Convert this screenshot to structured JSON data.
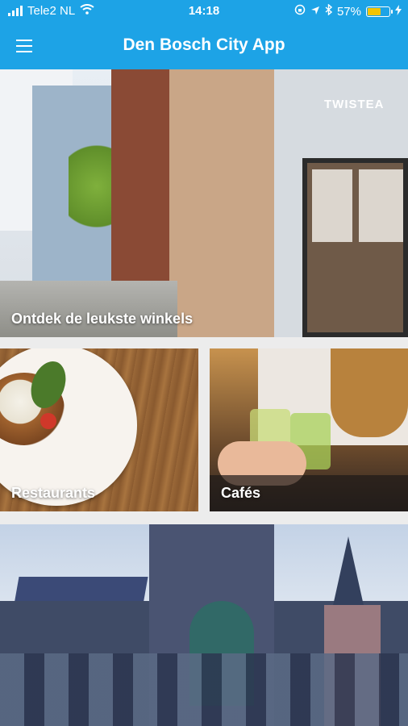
{
  "status_bar": {
    "carrier": "Tele2 NL",
    "time": "14:18",
    "battery_percent": "57%",
    "battery_level": 0.57,
    "icons": [
      "signal-icon",
      "wifi-icon",
      "rotation-lock-icon",
      "location-icon",
      "bluetooth-icon",
      "battery-icon",
      "charging-icon"
    ]
  },
  "app_bar": {
    "title": "Den Bosch City App",
    "menu_icon": "hamburger-menu-icon"
  },
  "tiles": {
    "shops": {
      "label": "Ontdek de leukste winkels",
      "sign_text": "TWISTEA"
    },
    "restaurants": {
      "label": "Restaurants"
    },
    "cafes": {
      "label": "Cafés"
    },
    "cathedral": {
      "label": ""
    }
  },
  "colors": {
    "primary": "#1da3e6",
    "background": "#ececec",
    "battery_fill": "#f5c400"
  }
}
